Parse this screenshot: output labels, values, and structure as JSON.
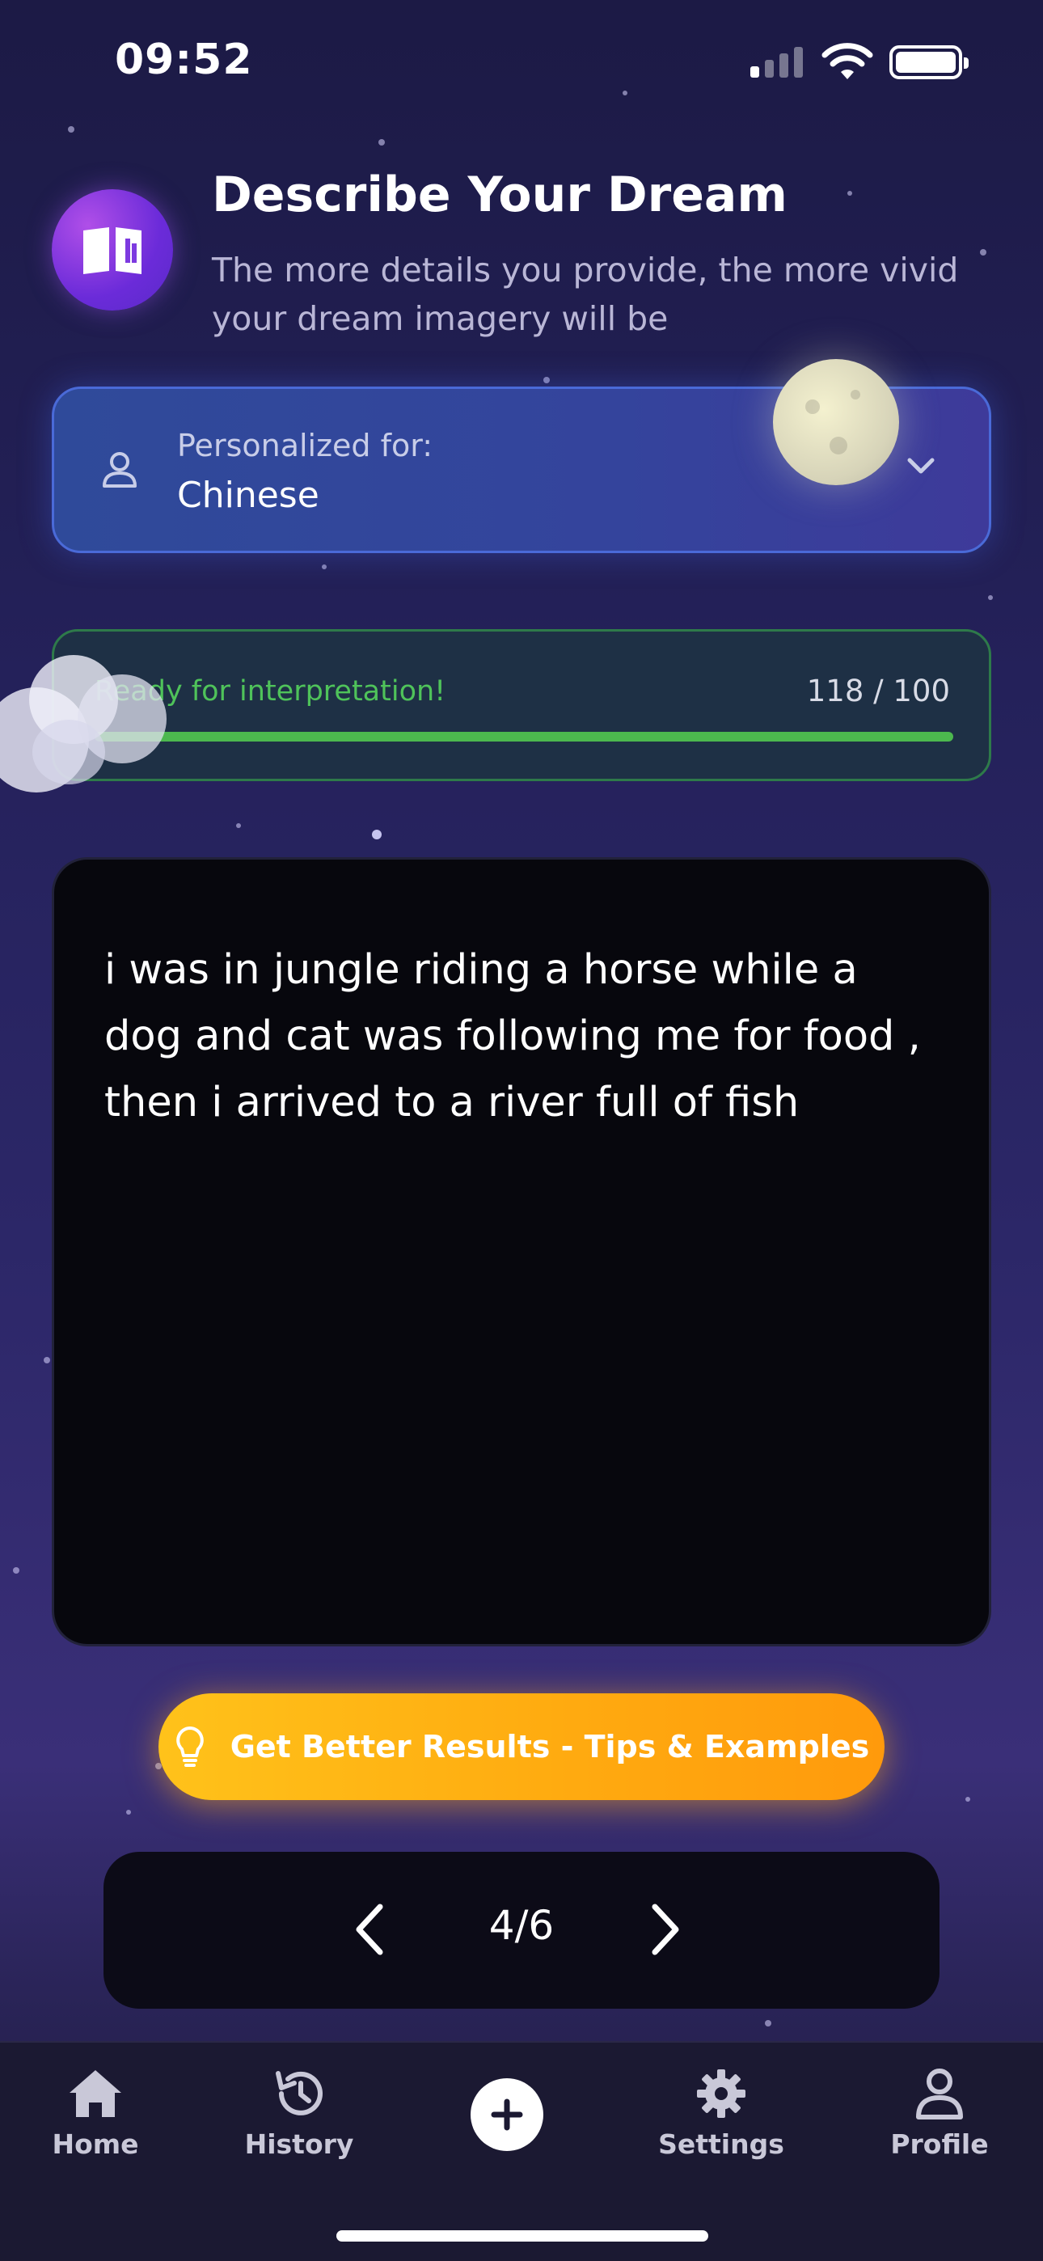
{
  "status_bar": {
    "time": "09:52"
  },
  "header": {
    "title": "Describe Your Dream",
    "subtitle": "The more details you provide, the more vivid your dream imagery will be",
    "icon": "open-book-icon"
  },
  "persona": {
    "label": "Personalized for:",
    "value": "Chinese",
    "icon": "user-outline-icon",
    "dropdown_icon": "chevron-down-icon"
  },
  "progress": {
    "status": "Ready for interpretation!",
    "count_text": "118 / 100",
    "fill_percent": 100,
    "color": "#4cb84e"
  },
  "dream_input": {
    "value": "i was in jungle riding a horse  while a dog and cat was following me for food , then i arrived to a river full of fish"
  },
  "tips_button": {
    "label": "Get Better Results - Tips & Examples",
    "icon": "lightbulb-icon",
    "color": "#ffb014"
  },
  "pager": {
    "text": "4/6",
    "prev_icon": "chevron-left-icon",
    "next_icon": "chevron-right-icon"
  },
  "tabbar": {
    "items": [
      {
        "label": "Home",
        "icon": "home-icon"
      },
      {
        "label": "History",
        "icon": "history-icon"
      },
      {
        "label": "",
        "icon": "plus-circle-icon"
      },
      {
        "label": "Settings",
        "icon": "gear-icon"
      },
      {
        "label": "Profile",
        "icon": "person-icon"
      }
    ]
  }
}
